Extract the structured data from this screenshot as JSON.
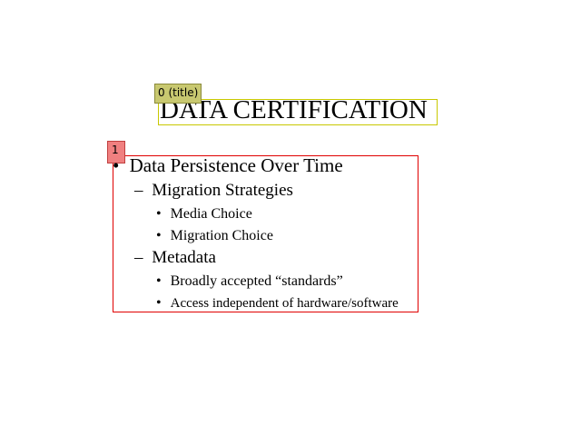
{
  "annotations": {
    "title_tag": "0 (title)",
    "body_tag": "1"
  },
  "slide": {
    "title": "DATA CERTIFICATION",
    "bullets": [
      {
        "marker": "•",
        "text": "Data Persistence Over Time"
      },
      {
        "marker": "–",
        "text": "Migration Strategies"
      },
      {
        "marker": "•",
        "text": "Media Choice"
      },
      {
        "marker": "•",
        "text": "Migration Choice"
      },
      {
        "marker": "–",
        "text": "Metadata"
      },
      {
        "marker": "•",
        "text": "Broadly accepted “standards”"
      },
      {
        "marker": "•",
        "text": "Access independent of hardware/software"
      }
    ]
  },
  "colors": {
    "title_box": "#c8c800",
    "title_tag_bg": "#c8c870",
    "body_box": "#e00000",
    "body_tag_bg": "#f08080"
  }
}
